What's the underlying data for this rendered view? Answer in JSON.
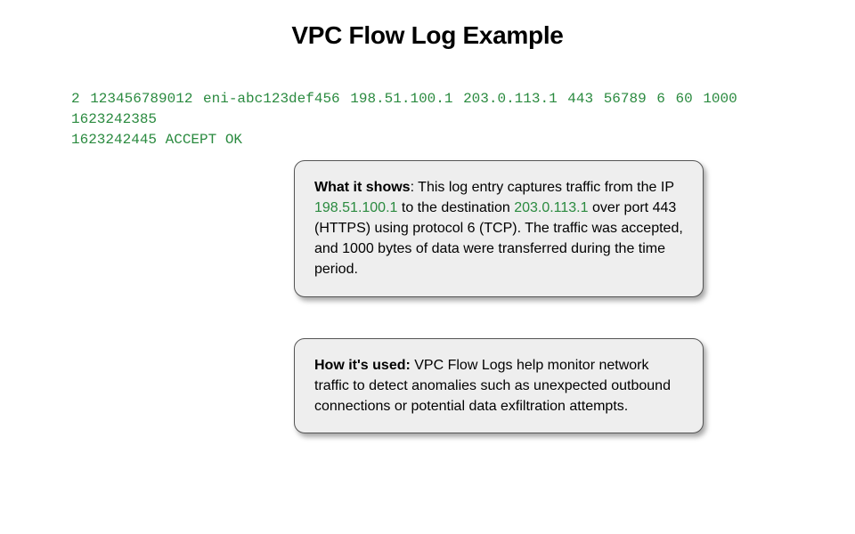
{
  "title": "VPC Flow Log Example",
  "log": {
    "main": "2 123456789012 eni-abc123def456 198.51.100.1 203.0.113.1 443 56789 6 60 1000 1623242385",
    "tail": "1623242445 ACCEPT OK"
  },
  "card1": {
    "label": "What it shows",
    "pre": ": This log entry captures traffic from the IP ",
    "ip1": "198.51.100.1",
    "mid": " to the destination ",
    "ip2": "203.0.113.1",
    "post": " over port 443 (HTTPS) using protocol 6 (TCP). The traffic was accepted, and 1000 bytes of data were transferred during the time period."
  },
  "card2": {
    "label": "How it's used:",
    "text": "  VPC Flow Logs help monitor network traffic to detect anomalies such as unexpected outbound connections or potential data exfiltration attempts."
  }
}
